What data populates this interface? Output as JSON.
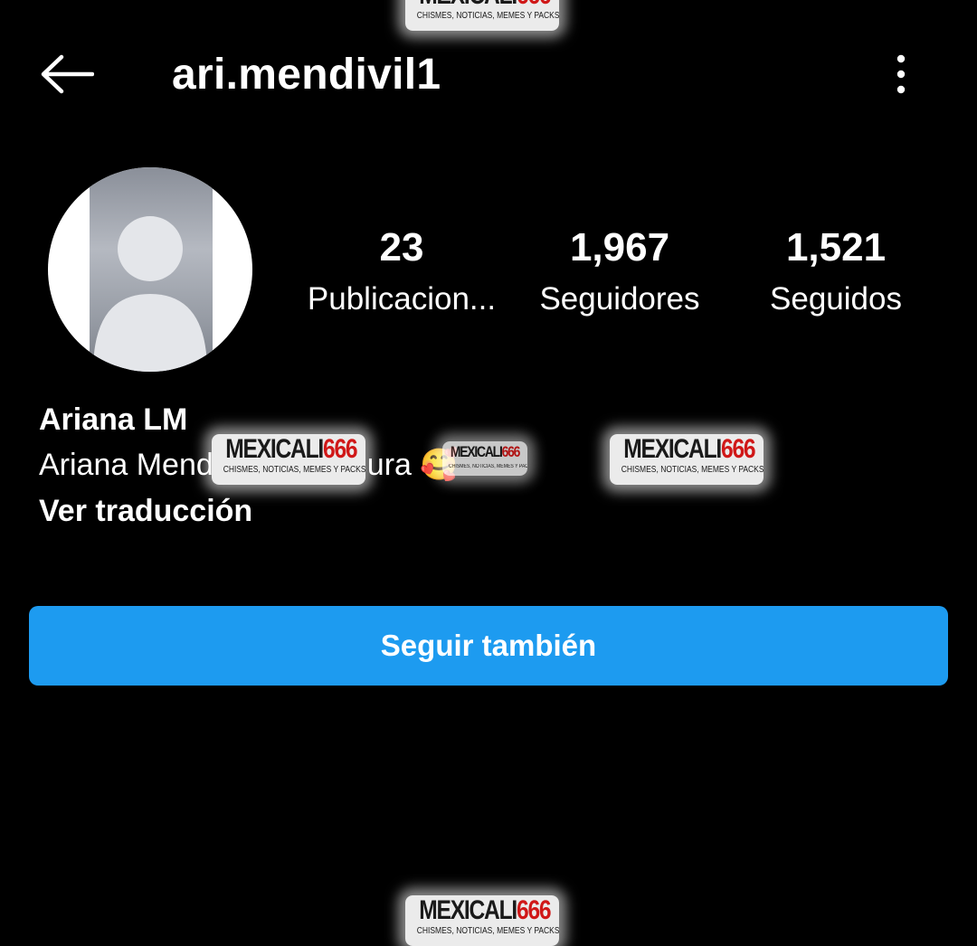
{
  "header": {
    "username": "ari.mendivil1",
    "back_icon": "arrow-left-icon",
    "more_icon": "kebab-menu-icon"
  },
  "profile": {
    "avatar_icon": "profile-photo-placeholder"
  },
  "stats": {
    "posts": {
      "count": "23",
      "label": "Publicacion..."
    },
    "followers": {
      "count": "1,967",
      "label": "Seguidores"
    },
    "following": {
      "count": "1,521",
      "label": "Seguidos"
    }
  },
  "bio": {
    "name": "Ariana LM",
    "text_start": "Ariana Mend",
    "text_end": "ura",
    "emoji": "🥰",
    "translate_label": "Ver traducción"
  },
  "actions": {
    "follow_label": "Seguir también"
  },
  "watermark": {
    "brand": "MEXICALI",
    "brand_number": "666",
    "tagline": "CHISMES, NOTICIAS, MEMES Y PACKS"
  },
  "colors": {
    "background": "#000000",
    "text": "#ffffff",
    "follow_button": "#1d9bf0",
    "watermark_accent": "#d01818"
  }
}
